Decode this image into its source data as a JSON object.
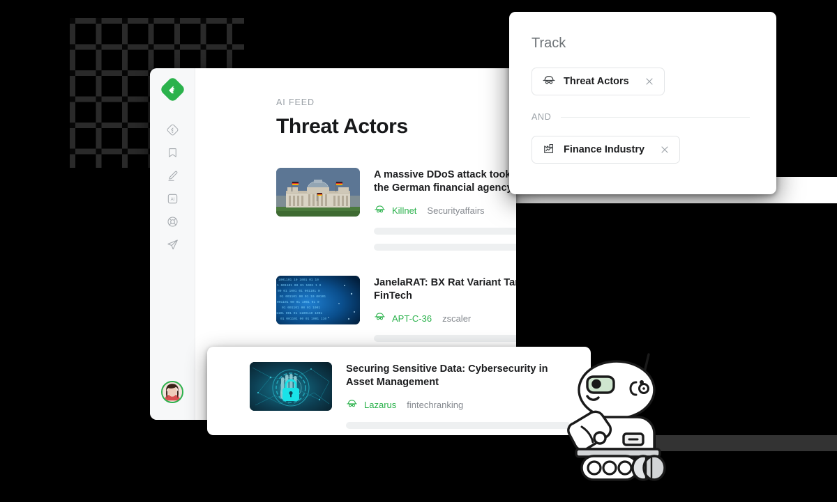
{
  "background": {
    "color": "#000000",
    "grid_dot_color": "#2a2a2a",
    "band_color": "#333333"
  },
  "app": {
    "sidebar": {
      "logo": "feedly-logo",
      "items": [
        {
          "icon": "feed-diamond-icon",
          "label": "Feeds"
        },
        {
          "icon": "bookmark-icon",
          "label": "Boards"
        },
        {
          "icon": "pen-highlight-icon",
          "label": "Highlights"
        },
        {
          "icon": "ai-icon",
          "label": "AI"
        },
        {
          "icon": "lifebuoy-icon",
          "label": "Support"
        },
        {
          "icon": "paper-plane-icon",
          "label": "Share"
        }
      ],
      "avatar": "user-avatar"
    },
    "feed": {
      "eyebrow": "AI FEED",
      "title": "Threat Actors",
      "articles": [
        {
          "title_line1": "A massive DDoS attack took down the site of",
          "title_line2": "the German financial agency BaFin",
          "actor": "Killnet",
          "source": "Securityaffairs",
          "thumb": "reichstag-building-photo",
          "skeleton_widths": [
            "312px",
            "342px"
          ]
        },
        {
          "title_line1": "JanelaRAT: BX Rat Variant Targeting LATAM",
          "title_line2": "FinTech",
          "actor": "APT-C-36",
          "source": "zscaler",
          "thumb": "binary-code-photo",
          "skeleton_widths": [
            "315px",
            "283px"
          ]
        }
      ]
    }
  },
  "float_card": {
    "title_line1": "Securing Sensitive Data: Cybersecurity in",
    "title_line2": "Asset Management",
    "actor": "Lazarus",
    "source": "fintechranking",
    "thumb": "padlock-hand-photo",
    "skeleton_widths": [
      "322px"
    ]
  },
  "track_panel": {
    "title": "Track",
    "chips": [
      {
        "icon": "spy-hat-icon",
        "label": "Threat Actors",
        "close": "close-icon"
      },
      {
        "icon": "factory-chart-icon",
        "label": "Finance Industry",
        "close": "close-icon"
      }
    ],
    "operator": "AND"
  },
  "robot": {
    "name": "leo-robot-mascot",
    "eye_color": "#cfe6cf"
  },
  "colors": {
    "accent_green": "#2bb24c",
    "text_primary": "#1c1d1f",
    "text_muted": "#9aa0a6"
  }
}
